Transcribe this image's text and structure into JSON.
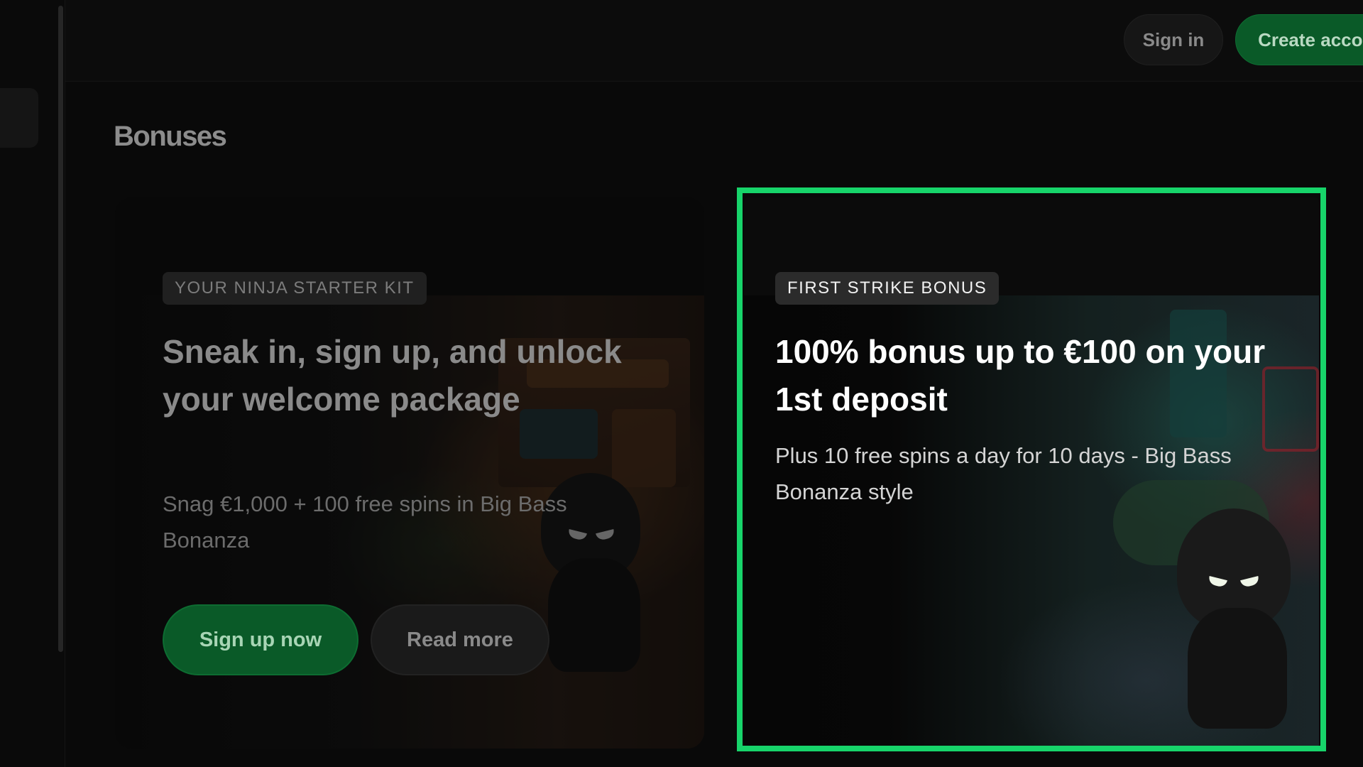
{
  "header": {
    "signin_label": "Sign in",
    "create_account_label": "Create account"
  },
  "page": {
    "title": "Bonuses"
  },
  "bonuses": [
    {
      "badge": "YOUR NINJA STARTER KIT",
      "headline": "Sneak in, sign up, and unlock your welcome package",
      "subtext": "Snag €1,000 + 100 free spins in Big Bass Bonanza",
      "primary_cta": "Sign up now",
      "secondary_cta": "Read more"
    },
    {
      "badge": "FIRST STRIKE BONUS",
      "headline": "100% bonus up to €100 on your 1st deposit",
      "subtext": "Plus 10 free spins a day for 10 days - Big Bass Bonanza style",
      "highlighted": true
    }
  ],
  "colors": {
    "accent_green": "#0a5a28",
    "highlight_green": "#17d46a",
    "background": "#090909"
  }
}
